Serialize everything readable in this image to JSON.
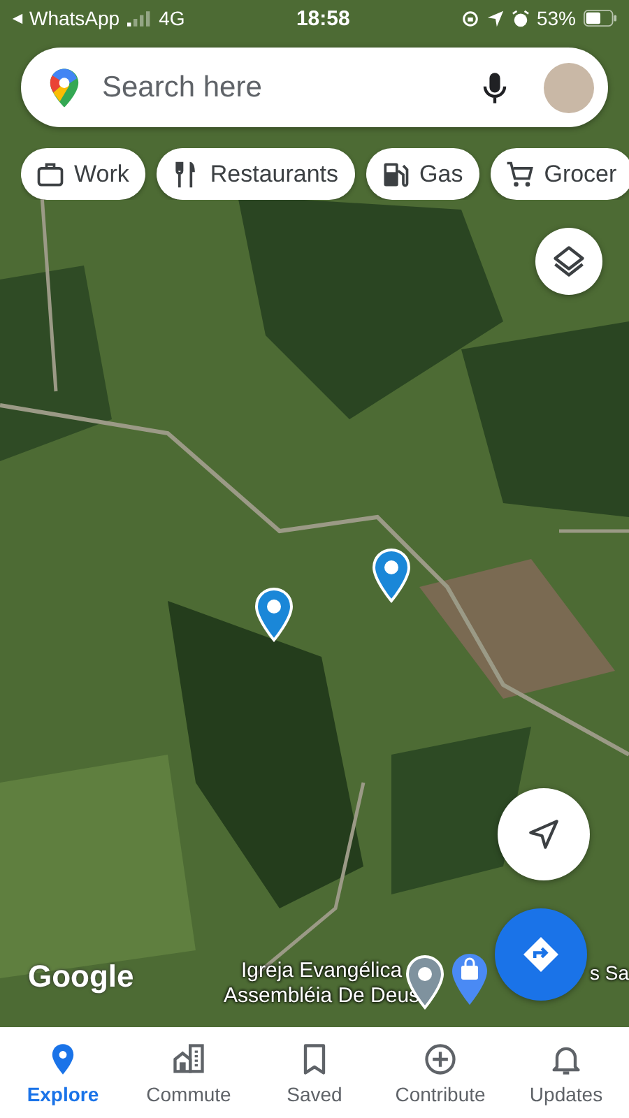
{
  "status_bar": {
    "back_app": "WhatsApp",
    "network": "4G",
    "time": "18:58",
    "battery": "53%"
  },
  "search": {
    "placeholder": "Search here"
  },
  "chips": [
    {
      "label": "Work",
      "kind": "work"
    },
    {
      "label": "Restaurants",
      "kind": "restaurants"
    },
    {
      "label": "Gas",
      "kind": "gas"
    },
    {
      "label": "Grocer",
      "kind": "grocery"
    }
  ],
  "map": {
    "logo": "Google",
    "labels": [
      "Igreja Evangélica\nAssembléia De Deus",
      "s Sa"
    ],
    "pins": [
      {
        "kind": "dot",
        "color": "#1a87d8"
      },
      {
        "kind": "dot",
        "color": "#1a87d8"
      },
      {
        "kind": "dot",
        "color": "#7f929e"
      },
      {
        "kind": "bag",
        "color": "#4a8af4"
      }
    ]
  },
  "nav": [
    {
      "label": "Explore",
      "kind": "explore",
      "selected": true
    },
    {
      "label": "Commute",
      "kind": "commute",
      "selected": false
    },
    {
      "label": "Saved",
      "kind": "saved",
      "selected": false
    },
    {
      "label": "Contribute",
      "kind": "contribute",
      "selected": false
    },
    {
      "label": "Updates",
      "kind": "updates",
      "selected": false
    }
  ]
}
